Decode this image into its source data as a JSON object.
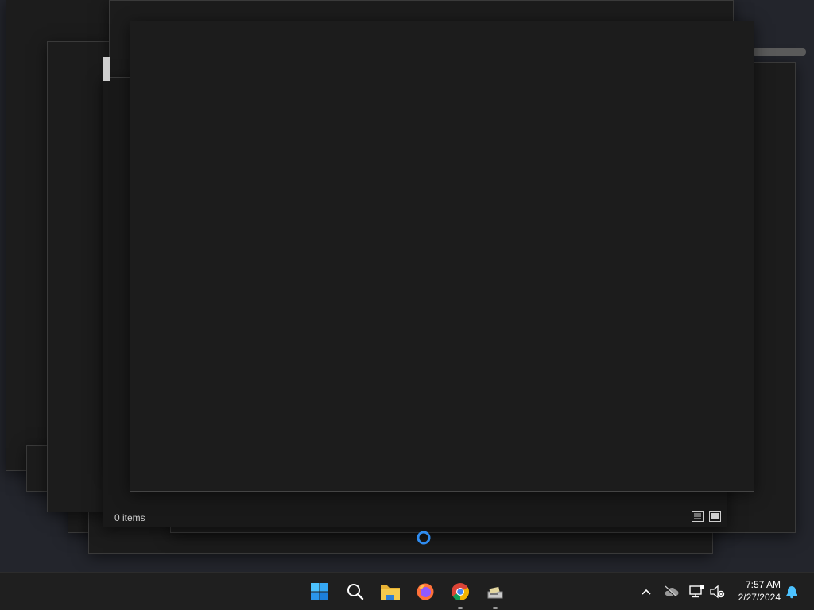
{
  "file_explorer": {
    "status_items": "0 items"
  },
  "taskbar": {
    "apps": [
      {
        "name": "Start",
        "icon": "windows-start-icon"
      },
      {
        "name": "Search",
        "icon": "search-icon"
      },
      {
        "name": "File Explorer",
        "icon": "folder-icon"
      },
      {
        "name": "Firefox",
        "icon": "firefox-icon"
      },
      {
        "name": "Google Chrome",
        "icon": "chrome-icon"
      },
      {
        "name": "Installer",
        "icon": "installer-icon"
      }
    ],
    "tray": {
      "icons": [
        "chevron-up-icon",
        "onedrive-offline-icon",
        "network-icon",
        "volume-muted-icon",
        "notification-bell-icon"
      ]
    },
    "clock": {
      "time": "7:57 AM",
      "date": "2/27/2024"
    }
  },
  "colors": {
    "accent": "#2f8cf0",
    "window_bg": "#1c1c1c",
    "taskbar_bg": "#1f1f1f"
  }
}
